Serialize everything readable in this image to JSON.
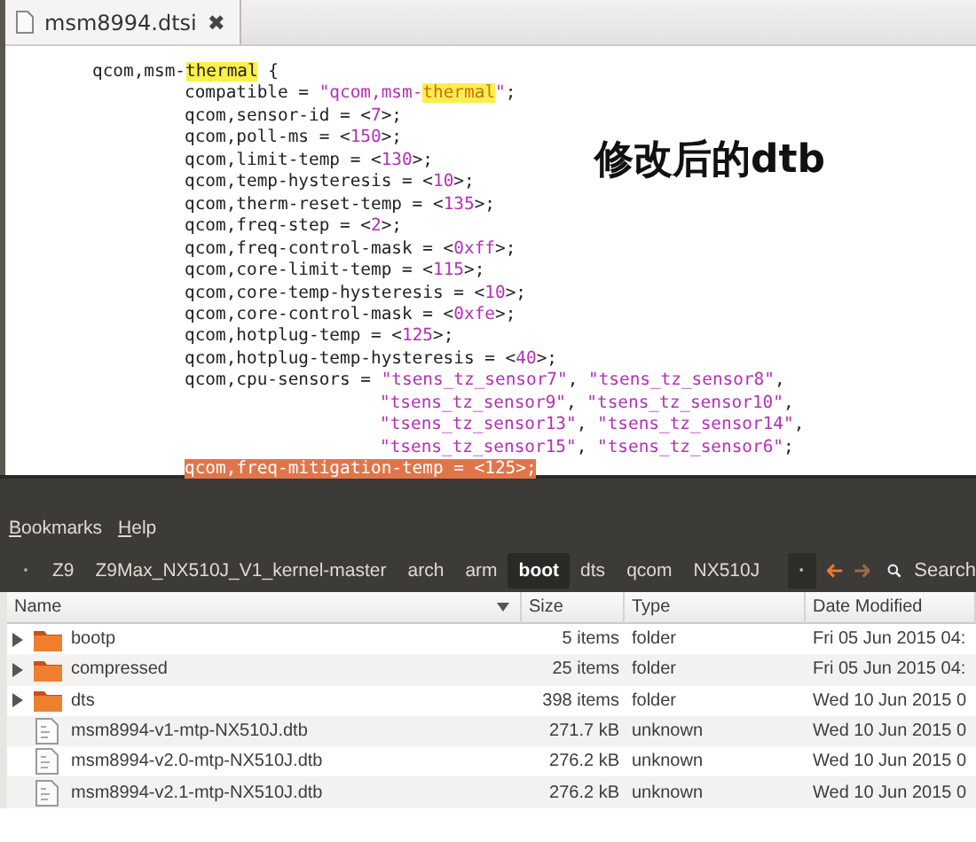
{
  "editor": {
    "tab": {
      "title": "msm8994.dtsi",
      "close": "✖"
    },
    "code": [
      {
        "segments": [
          {
            "kind": "text",
            "text": "qcom,msm-"
          },
          {
            "kind": "match",
            "text": "thermal"
          },
          {
            "kind": "text",
            "text": " {"
          }
        ],
        "children": [
          {
            "segments": [
              {
                "kind": "text",
                "text": "compatible = "
              },
              {
                "kind": "str",
                "text": "\"qcom,msm-"
              },
              {
                "kind": "strmatch",
                "text": "thermal"
              },
              {
                "kind": "str",
                "text": "\""
              },
              {
                "kind": "text",
                "text": ";"
              }
            ]
          },
          {
            "segments": [
              {
                "kind": "text",
                "text": "qcom,sensor-id = <"
              },
              {
                "kind": "num",
                "text": "7"
              },
              {
                "kind": "text",
                "text": ">;"
              }
            ]
          },
          {
            "segments": [
              {
                "kind": "text",
                "text": "qcom,poll-ms = <"
              },
              {
                "kind": "num",
                "text": "150"
              },
              {
                "kind": "text",
                "text": ">;"
              }
            ]
          },
          {
            "segments": [
              {
                "kind": "text",
                "text": "qcom,limit-temp = <"
              },
              {
                "kind": "num",
                "text": "130"
              },
              {
                "kind": "text",
                "text": ">;"
              }
            ]
          },
          {
            "segments": [
              {
                "kind": "text",
                "text": "qcom,temp-hysteresis = <"
              },
              {
                "kind": "num",
                "text": "10"
              },
              {
                "kind": "text",
                "text": ">;"
              }
            ]
          },
          {
            "segments": [
              {
                "kind": "text",
                "text": "qcom,therm-reset-temp = <"
              },
              {
                "kind": "num",
                "text": "135"
              },
              {
                "kind": "text",
                "text": ">;"
              }
            ]
          },
          {
            "segments": [
              {
                "kind": "text",
                "text": "qcom,freq-step = <"
              },
              {
                "kind": "num",
                "text": "2"
              },
              {
                "kind": "text",
                "text": ">;"
              }
            ]
          },
          {
            "segments": [
              {
                "kind": "text",
                "text": "qcom,freq-control-mask = <"
              },
              {
                "kind": "num",
                "text": "0xff"
              },
              {
                "kind": "text",
                "text": ">;"
              }
            ]
          },
          {
            "segments": [
              {
                "kind": "text",
                "text": "qcom,core-limit-temp = <"
              },
              {
                "kind": "num",
                "text": "115"
              },
              {
                "kind": "text",
                "text": ">;"
              }
            ]
          },
          {
            "segments": [
              {
                "kind": "text",
                "text": "qcom,core-temp-hysteresis = <"
              },
              {
                "kind": "num",
                "text": "10"
              },
              {
                "kind": "text",
                "text": ">;"
              }
            ]
          },
          {
            "segments": [
              {
                "kind": "text",
                "text": "qcom,core-control-mask = <"
              },
              {
                "kind": "num",
                "text": "0xfe"
              },
              {
                "kind": "text",
                "text": ">;"
              }
            ]
          },
          {
            "segments": [
              {
                "kind": "text",
                "text": "qcom,hotplug-temp = <"
              },
              {
                "kind": "num",
                "text": "125"
              },
              {
                "kind": "text",
                "text": ">;"
              }
            ]
          },
          {
            "segments": [
              {
                "kind": "text",
                "text": "qcom,hotplug-temp-hysteresis = <"
              },
              {
                "kind": "num",
                "text": "40"
              },
              {
                "kind": "text",
                "text": ">;"
              }
            ]
          },
          {
            "segments": [
              {
                "kind": "text",
                "text": "qcom,cpu-sensors = "
              },
              {
                "kind": "str",
                "text": "\"tsens_tz_sensor7\""
              },
              {
                "kind": "text",
                "text": ", "
              },
              {
                "kind": "str",
                "text": "\"tsens_tz_sensor8\""
              },
              {
                "kind": "text",
                "text": ","
              }
            ],
            "children": [
              {
                "segments": [
                  {
                    "kind": "str",
                    "text": "\"tsens_tz_sensor9\""
                  },
                  {
                    "kind": "text",
                    "text": ", "
                  },
                  {
                    "kind": "str",
                    "text": "\"tsens_tz_sensor10\""
                  },
                  {
                    "kind": "text",
                    "text": ","
                  }
                ]
              },
              {
                "segments": [
                  {
                    "kind": "str",
                    "text": "\"tsens_tz_sensor13\""
                  },
                  {
                    "kind": "text",
                    "text": ", "
                  },
                  {
                    "kind": "str",
                    "text": "\"tsens_tz_sensor14\""
                  },
                  {
                    "kind": "text",
                    "text": ","
                  }
                ]
              },
              {
                "segments": [
                  {
                    "kind": "str",
                    "text": "\"tsens_tz_sensor15\""
                  },
                  {
                    "kind": "text",
                    "text": ", "
                  },
                  {
                    "kind": "str",
                    "text": "\"tsens_tz_sensor6\""
                  },
                  {
                    "kind": "text",
                    "text": ";"
                  }
                ]
              }
            ]
          },
          {
            "segments": [
              {
                "kind": "selection",
                "text": "qcom,freq-mitigation-temp = <125>;"
              }
            ]
          }
        ]
      }
    ],
    "annotation": "修改后的dtb"
  },
  "file_manager": {
    "menu": [
      "Bookmarks",
      "Help"
    ],
    "path_bar": {
      "scroll_left": "·",
      "crumbs": [
        {
          "label": "Z9",
          "selected": false
        },
        {
          "label": "Z9Max_NX510J_V1_kernel-master",
          "selected": false
        },
        {
          "label": "arch",
          "selected": false
        },
        {
          "label": "arm",
          "selected": false
        },
        {
          "label": "boot",
          "selected": true
        },
        {
          "label": "dts",
          "selected": false
        },
        {
          "label": "qcom",
          "selected": false
        },
        {
          "label": "NX510J",
          "selected": false
        }
      ],
      "scroll_right": "·",
      "search": "Search"
    },
    "table": {
      "columns": [
        "Name",
        "Size",
        "Type",
        "Date Modified"
      ],
      "rows": [
        {
          "kind": "folder",
          "name": "bootp",
          "size": "5 items",
          "type": "folder",
          "date": "Fri 05 Jun 2015 04:"
        },
        {
          "kind": "folder",
          "name": "compressed",
          "size": "25 items",
          "type": "folder",
          "date": "Fri 05 Jun 2015 04:"
        },
        {
          "kind": "folder",
          "name": "dts",
          "size": "398 items",
          "type": "folder",
          "date": "Wed 10 Jun 2015 0"
        },
        {
          "kind": "file",
          "name": "msm8994-v1-mtp-NX510J.dtb",
          "size": "271.7 kB",
          "type": "unknown",
          "date": "Wed 10 Jun 2015 0"
        },
        {
          "kind": "file",
          "name": "msm8994-v2.0-mtp-NX510J.dtb",
          "size": "276.2 kB",
          "type": "unknown",
          "date": "Wed 10 Jun 2015 0"
        },
        {
          "kind": "file",
          "name": "msm8994-v2.1-mtp-NX510J.dtb",
          "size": "276.2 kB",
          "type": "unknown",
          "date": "Wed 10 Jun 2015 0"
        }
      ]
    }
  }
}
